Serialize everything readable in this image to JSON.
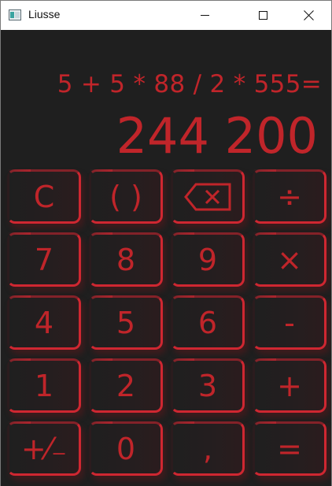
{
  "window": {
    "title": "Liusse"
  },
  "display": {
    "expression": "5 + 5 * 88 / 2 * 555=",
    "result": "244 200"
  },
  "keys": {
    "clear": "C",
    "parentheses": "( )",
    "divide": "÷",
    "seven": "7",
    "eight": "8",
    "nine": "9",
    "multiply": "×",
    "four": "4",
    "five": "5",
    "six": "6",
    "minus": "-",
    "one": "1",
    "two": "2",
    "three": "3",
    "plus": "+",
    "negate": "+⁄₋",
    "zero": "0",
    "decimal": ",",
    "equals": "="
  },
  "icons": {
    "backspace": "backspace-icon",
    "app": "app-icon",
    "minimize": "minimize-icon",
    "maximize": "maximize-icon",
    "close": "close-icon"
  },
  "colors": {
    "accent": "#c0252a",
    "background": "#1f1f1f",
    "titlebar": "#ffffff"
  }
}
